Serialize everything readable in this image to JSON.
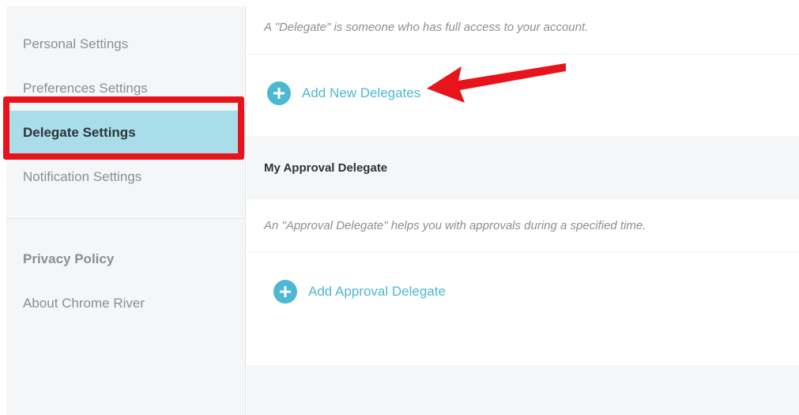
{
  "sidebar": {
    "items": [
      {
        "label": "Personal Settings"
      },
      {
        "label": "Preferences Settings"
      },
      {
        "label": "Delegate Settings"
      },
      {
        "label": "Notification Settings"
      }
    ],
    "secondary": [
      {
        "label": "Privacy Policy"
      },
      {
        "label": "About Chrome River"
      }
    ]
  },
  "delegates": {
    "description": "A \"Delegate\" is someone who has full access to your account.",
    "add_label": "Add New Delegates"
  },
  "approval": {
    "title": "My Approval Delegate",
    "description": "An \"Approval Delegate\" helps you with approvals during a specified time.",
    "add_label": "Add Approval Delegate"
  },
  "colors": {
    "accent": "#4db8d3",
    "active_bg": "#a8dde9",
    "annotation_red": "#e8141b"
  },
  "icons": {
    "add": "plus-circle-icon",
    "annotation": "red-arrow"
  }
}
